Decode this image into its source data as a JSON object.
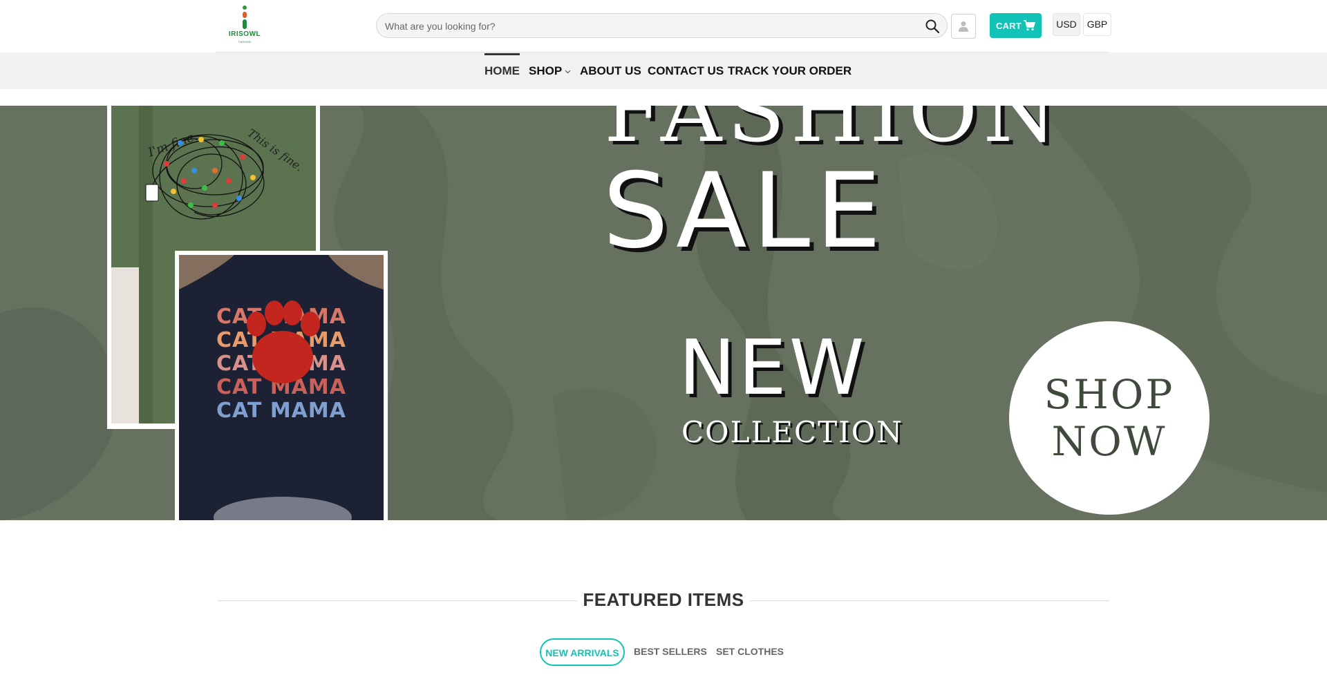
{
  "brand": {
    "name": "IRISOWL",
    "tagline": "FASHION",
    "accent_color": "#12c2b7"
  },
  "header": {
    "search": {
      "placeholder": "What are you looking for?",
      "value": "",
      "icon": "search-icon"
    },
    "account_icon": "user-icon",
    "cart": {
      "label": "CART",
      "icon": "cart-icon"
    },
    "currencies": [
      {
        "code": "USD",
        "selected": true
      },
      {
        "code": "GBP",
        "selected": false
      }
    ]
  },
  "nav": {
    "items": [
      {
        "label": "HOME",
        "active": true
      },
      {
        "label": "SHOP",
        "has_dropdown": true
      },
      {
        "label": "ABOUT US"
      },
      {
        "label": "CONTACT US"
      },
      {
        "label": "TRACK YOUR ORDER"
      }
    ]
  },
  "hero": {
    "headline_top": "FASHION",
    "headline": "SALE",
    "sub_headline": "NEW",
    "sub_caption": "COLLECTION",
    "cta_line1": "SHOP",
    "cta_line2": "NOW",
    "shirt_green_text_left": "I'm fine.",
    "shirt_green_text_right": "This is fine.",
    "shirt_navy_lines": [
      "CAT MAMA",
      "CAT MAMA",
      "CAT MAMA",
      "CAT MAMA",
      "CAT MAMA"
    ]
  },
  "featured": {
    "title": "FEATURED ITEMS",
    "tabs": [
      {
        "label": "NEW ARRIVALS",
        "active": true
      },
      {
        "label": "BEST SELLERS",
        "active": false
      },
      {
        "label": "SET CLOTHES",
        "active": false
      }
    ]
  }
}
